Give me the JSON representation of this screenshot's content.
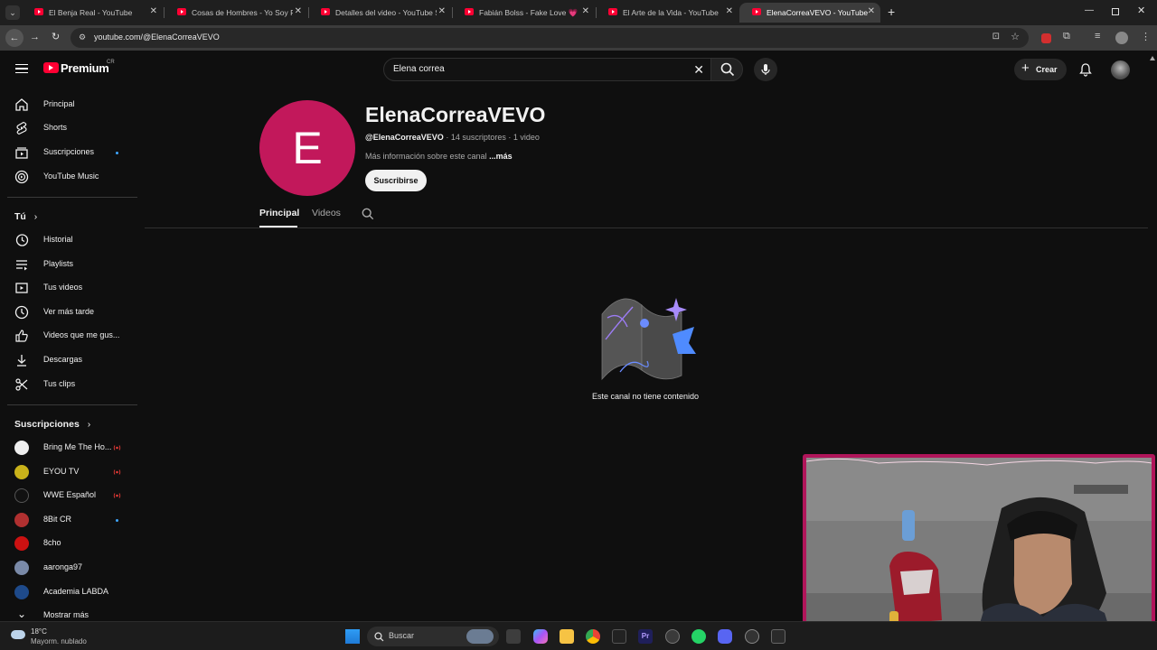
{
  "browser": {
    "tabs": [
      {
        "title": "El Benja Real - YouTube"
      },
      {
        "title": "Cosas de Hombres - Yo Soy Po"
      },
      {
        "title": "Detalles del video - YouTube St"
      },
      {
        "title": "Fabián Bolss - Fake Love 💗 (Vi"
      },
      {
        "title": "El Arte de la Vida - YouTube"
      },
      {
        "title": "ElenaCorreaVEVO - YouTube"
      }
    ],
    "url": "youtube.com/@ElenaCorreaVEVO"
  },
  "header": {
    "logo_text": "Premium",
    "logo_region": "CR",
    "search_value": "Elena correa",
    "create_label": "Crear"
  },
  "sidebar": {
    "main": [
      {
        "label": "Principal",
        "icon": "home-icon"
      },
      {
        "label": "Shorts",
        "icon": "shorts-icon"
      },
      {
        "label": "Suscripciones",
        "icon": "subscriptions-icon"
      },
      {
        "label": "YouTube Music",
        "icon": "youtube-music-icon"
      }
    ],
    "you_heading": "Tú",
    "you": [
      {
        "label": "Historial",
        "icon": "history-icon"
      },
      {
        "label": "Playlists",
        "icon": "playlists-icon"
      },
      {
        "label": "Tus videos",
        "icon": "your-videos-icon"
      },
      {
        "label": "Ver más tarde",
        "icon": "watch-later-icon"
      },
      {
        "label": "Videos que me gus...",
        "icon": "liked-videos-icon"
      },
      {
        "label": "Descargas",
        "icon": "downloads-icon"
      },
      {
        "label": "Tus clips",
        "icon": "clips-icon"
      }
    ],
    "subs_heading": "Suscripciones",
    "subs": [
      {
        "label": "Bring Me The Ho...",
        "color": "#eeeeee",
        "status": "live"
      },
      {
        "label": "EYOU TV",
        "color": "#c9b21a",
        "status": "live"
      },
      {
        "label": "WWE Español",
        "color": "#111111",
        "status": "live"
      },
      {
        "label": "8Bit CR",
        "color": "#b03030",
        "status": "new"
      },
      {
        "label": "8cho",
        "color": "#cc1111",
        "status": ""
      },
      {
        "label": "aaronga97",
        "color": "#7a8aa8",
        "status": ""
      },
      {
        "label": "Academia LABDA",
        "color": "#1e4a8a",
        "status": ""
      }
    ],
    "show_more": "Mostrar más"
  },
  "channel": {
    "avatar_letter": "E",
    "avatar_color": "#c2185b",
    "name": "ElenaCorreaVEVO",
    "handle": "@ElenaCorreaVEVO",
    "subscribers": "14 suscriptores",
    "videos": "1 video",
    "description": "Más información sobre este canal",
    "more": "...más",
    "subscribe_label": "Suscribirse",
    "tabs": [
      "Principal",
      "Videos"
    ],
    "empty_message": "Este canal no tiene contenido"
  },
  "taskbar": {
    "weather_temp": "18°C",
    "weather_desc": "Mayorm. nublado",
    "search_placeholder": "Buscar"
  }
}
